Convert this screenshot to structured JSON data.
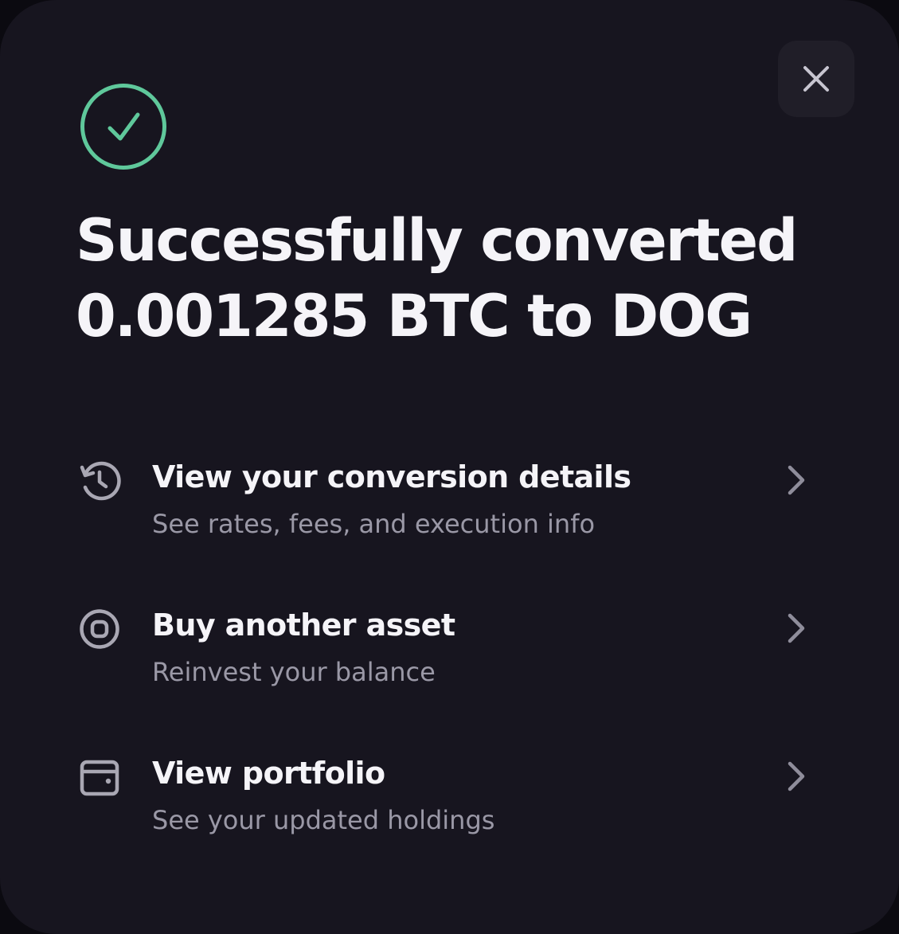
{
  "modal": {
    "title_line1": "Successfully converted",
    "title_line2": "0.001285 BTC to DOG",
    "close_icon": "close-icon",
    "status_icon": "check-circle-icon",
    "accent_color": "#5fc89b"
  },
  "actions": [
    {
      "label": "View your conversion details",
      "subtitle": "See rates, fees, and execution info",
      "icon": "history-icon"
    },
    {
      "label": "Buy another asset",
      "subtitle": "Reinvest your balance",
      "icon": "target-icon"
    },
    {
      "label": "View portfolio",
      "subtitle": "See your updated holdings",
      "icon": "wallet-icon"
    }
  ]
}
